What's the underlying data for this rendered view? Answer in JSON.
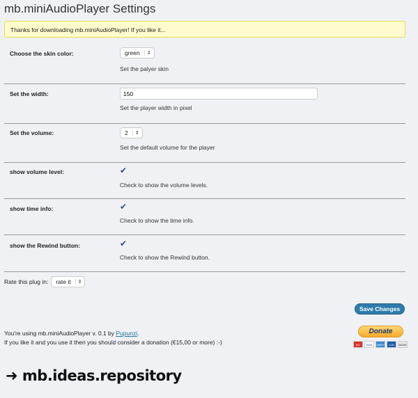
{
  "title": "mb.miniAudioPlayer Settings",
  "notice": "Thanks for downloading mb.miniAudioPlayer! If you like it...",
  "settings": [
    {
      "label": "Choose the skin color:",
      "type": "select",
      "value": "green",
      "help": "Set the palyer skin"
    },
    {
      "label": "Set the width:",
      "type": "input",
      "value": "150",
      "help": "Set the player width in pixel"
    },
    {
      "label": "Set the volume:",
      "type": "select",
      "value": "2",
      "help": "Set the default volume for the player"
    },
    {
      "label": "show volume level:",
      "type": "checkbox",
      "checked": true,
      "help": "Check to show the volume levels."
    },
    {
      "label": "show time info:",
      "type": "checkbox",
      "checked": true,
      "help": "Check to show the time info."
    },
    {
      "label": "show the Rewind button:",
      "type": "checkbox",
      "checked": true,
      "help": "Check to show the Rewind button."
    }
  ],
  "rate": {
    "label": "Rate this plug in:",
    "value": "rate it"
  },
  "save_label": "Save Changes",
  "footer": {
    "line1_prefix": "You're using mb.miniAudioPlayer v. 0.1 by ",
    "author_link": "Pupunzi",
    "line1_suffix": ".",
    "line2": "If you like it and you use it then you should consider a donation (€15,00 or more) :-)"
  },
  "donate_label": "Donate",
  "cards": [
    "MC",
    "VISA",
    "AMEX",
    "JCB",
    "BANK"
  ],
  "logo": "➜ mb.ideas.repository"
}
